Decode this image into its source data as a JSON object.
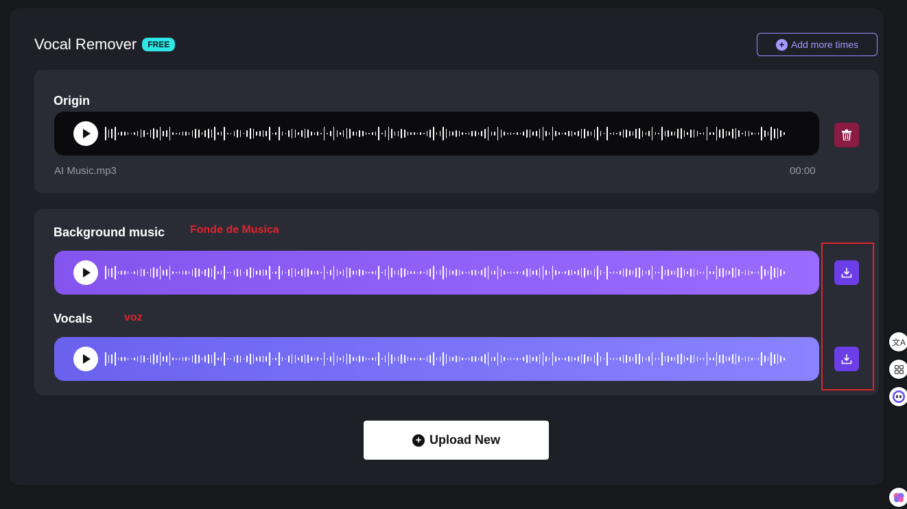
{
  "header": {
    "title": "Vocal Remover",
    "badge": "FREE",
    "add_more_label": "Add more times"
  },
  "origin": {
    "title": "Origin",
    "filename": "AI Music.mp3",
    "time": "00:00"
  },
  "results": {
    "background_title": "Background music",
    "background_annotation": "Fonde de Musica",
    "vocals_title": "Vocals",
    "vocals_annotation": "voz"
  },
  "upload_label": "Upload New",
  "colors": {
    "accent": "#6c3ee8",
    "background_track": "#8554ef",
    "vocals_track": "#6a62ef",
    "delete": "#8a1c44",
    "annotation": "#e2232b",
    "badge": "#2ee6e6"
  },
  "icons": {
    "play": "play-icon",
    "delete": "trash-icon",
    "download": "download-icon",
    "add": "plus-circle-icon",
    "translate": "translate-icon",
    "apps": "apps-grid-icon",
    "assistant": "assistant-icon",
    "brain": "brain-icon"
  }
}
